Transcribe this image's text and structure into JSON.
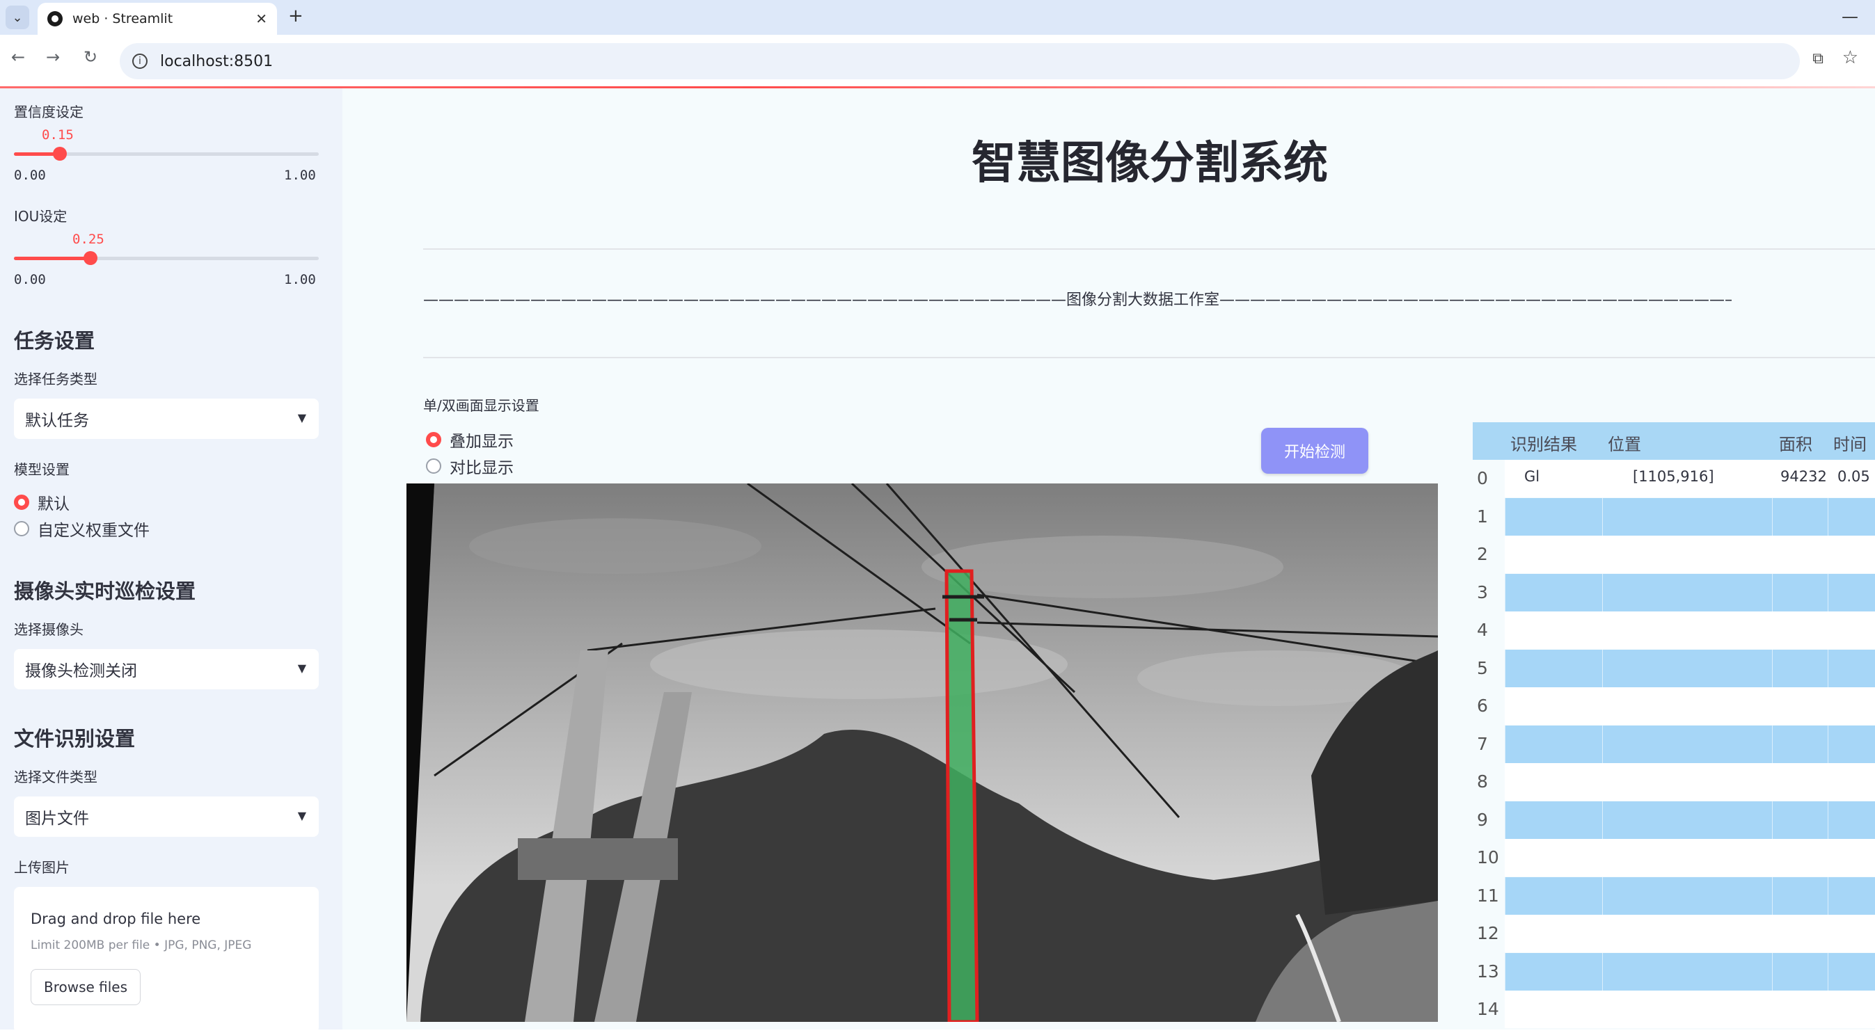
{
  "browser": {
    "tab_title": "web · Streamlit",
    "url": "localhost:8501"
  },
  "sidebar": {
    "confidence": {
      "label": "置信度设定",
      "value": "0.15",
      "min": "0.00",
      "max": "1.00",
      "fraction": 0.15
    },
    "iou": {
      "label": "IOU设定",
      "value": "0.25",
      "min": "0.00",
      "max": "1.00",
      "fraction": 0.25
    },
    "task_heading": "任务设置",
    "task_label": "选择任务类型",
    "task_value": "默认任务",
    "model_label": "模型设置",
    "model_options": [
      "默认",
      "自定义权重文件"
    ],
    "camera_heading": "摄像头实时巡检设置",
    "camera_label": "选择摄像头",
    "camera_value": "摄像头检测关闭",
    "file_heading": "文件识别设置",
    "file_type_label": "选择文件类型",
    "file_type_value": "图片文件",
    "upload_label": "上传图片",
    "upload_title": "Drag and drop file here",
    "upload_limit": "Limit 200MB per file • JPG, PNG, JPEG",
    "browse_label": "Browse files"
  },
  "main": {
    "title": "智慧图像分割系统",
    "studio_line": "——————————————————————————————————————————图像分割大数据工作室——————————————————————————————————————————",
    "display_label": "单/双画面显示设置",
    "display_options": [
      "叠加显示",
      "对比显示"
    ],
    "detect_button": "开始检测"
  },
  "table": {
    "headers": [
      "识别结果",
      "位置",
      "面积",
      "时间"
    ],
    "rows": [
      {
        "index": "0",
        "result": "Gl",
        "position": "[1105,916]",
        "area": "94232",
        "time": "0.05"
      },
      {
        "index": "1"
      },
      {
        "index": "2"
      },
      {
        "index": "3"
      },
      {
        "index": "4"
      },
      {
        "index": "5"
      },
      {
        "index": "6"
      },
      {
        "index": "7"
      },
      {
        "index": "8"
      },
      {
        "index": "9"
      },
      {
        "index": "10"
      },
      {
        "index": "11"
      },
      {
        "index": "12"
      },
      {
        "index": "13"
      },
      {
        "index": "14"
      }
    ]
  },
  "colors": {
    "accent": "#ff4b4b",
    "button": "#8f93f7",
    "table_row": "#a6d6f7",
    "mask_fill": "#3fae5f",
    "mask_border": "#e02020"
  }
}
